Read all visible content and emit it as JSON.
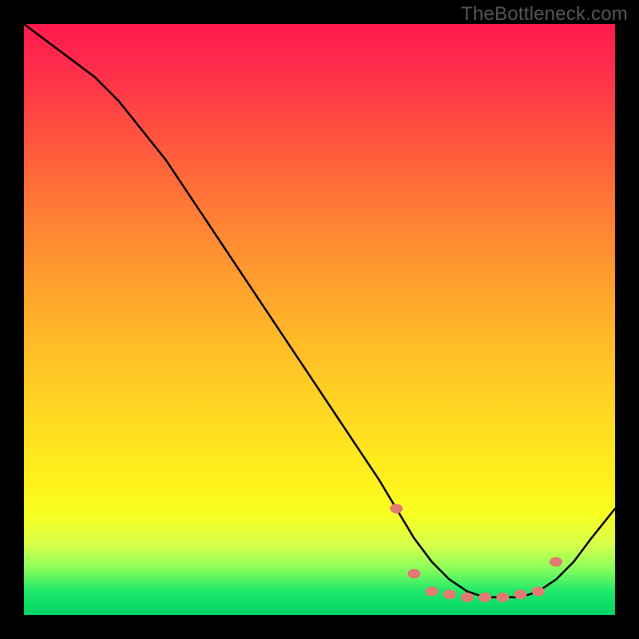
{
  "watermark": "TheBottleneck.com",
  "chart_data": {
    "type": "line",
    "title": "",
    "xlabel": "",
    "ylabel": "",
    "xlim": [
      0,
      100
    ],
    "ylim": [
      0,
      100
    ],
    "grid": false,
    "legend": false,
    "series": [
      {
        "name": "curve",
        "x": [
          0,
          4,
          8,
          12,
          16,
          20,
          24,
          28,
          32,
          36,
          40,
          44,
          48,
          52,
          56,
          60,
          63,
          66,
          69,
          72,
          75,
          78,
          81,
          84,
          87,
          90,
          93,
          96,
          100
        ],
        "y": [
          100,
          97,
          94,
          91,
          87,
          82,
          77,
          71,
          65,
          59,
          53,
          47,
          41,
          35,
          29,
          23,
          18,
          13,
          9,
          6,
          4,
          3,
          3,
          3,
          4,
          6,
          9,
          13,
          18
        ]
      }
    ],
    "markers": {
      "name": "highlight-dots",
      "x": [
        63,
        66,
        69,
        72,
        75,
        78,
        81,
        84,
        87,
        90
      ],
      "y": [
        18,
        7,
        4,
        3.5,
        3,
        3,
        3,
        3.5,
        4,
        9
      ]
    },
    "colors": {
      "curve": "#000000",
      "dots": "#e37a72",
      "gradient_top": "#ff1a4d",
      "gradient_mid": "#fff31c",
      "gradient_bottom": "#00d465"
    }
  }
}
